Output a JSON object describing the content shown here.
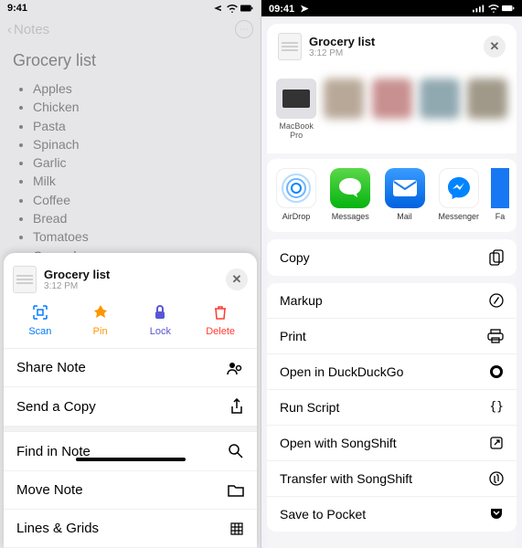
{
  "left": {
    "status_time": "9:41",
    "nav_back_label": "Notes",
    "note_title": "Grocery list",
    "items": [
      "Apples",
      "Chicken",
      "Pasta",
      "Spinach",
      "Garlic",
      "Milk",
      "Coffee",
      "Bread",
      "Tomatoes",
      "Cucumbers"
    ],
    "sheet": {
      "title": "Grocery list",
      "subtitle": "3:12 PM",
      "quick": {
        "scan": "Scan",
        "pin": "Pin",
        "lock": "Lock",
        "delete": "Delete"
      },
      "rows": {
        "share_note": "Share Note",
        "send_copy": "Send a Copy",
        "find": "Find in Note",
        "move": "Move Note",
        "lines": "Lines & Grids"
      }
    }
  },
  "right": {
    "status_time": "09:41",
    "header": {
      "title": "Grocery list",
      "subtitle": "3:12 PM"
    },
    "contacts": [
      {
        "name": "MacBook Pro",
        "kind": "mac"
      },
      {
        "name": "",
        "kind": "blur"
      },
      {
        "name": "",
        "kind": "blur"
      },
      {
        "name": "",
        "kind": "blur"
      },
      {
        "name": "",
        "kind": "blur"
      }
    ],
    "apps": {
      "airdrop": "AirDrop",
      "messages": "Messages",
      "mail": "Mail",
      "messenger": "Messenger",
      "more": "Fa"
    },
    "actions": {
      "copy": "Copy",
      "markup": "Markup",
      "print": "Print",
      "open_ddg": "Open in DuckDuckGo",
      "run_script": "Run Script",
      "open_songshift": "Open with SongShift",
      "transfer_songshift": "Transfer with SongShift",
      "save_pocket": "Save to Pocket"
    }
  }
}
